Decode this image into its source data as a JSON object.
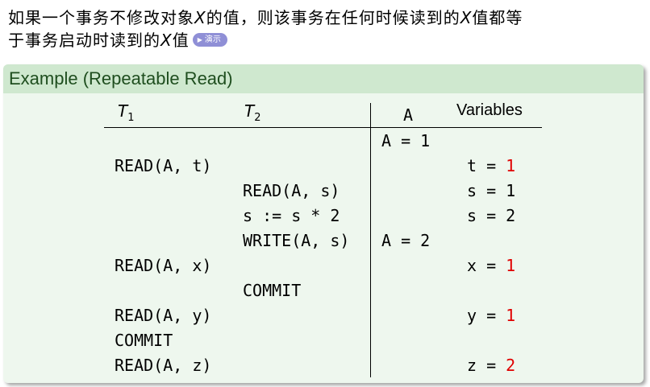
{
  "intro": {
    "line1_a": "如果一个事务不修改对象",
    "var_x": "X",
    "line1_b": "的值，则该事务在任何时候读到的",
    "line1_c": "值都等",
    "line2_a": "于事务启动时读到的",
    "line2_b": "值",
    "demo_label": "演示"
  },
  "block": {
    "title": "Example (Repeatable Read)"
  },
  "table": {
    "headers": {
      "t1": "T",
      "t1_sub": "1",
      "t2": "T",
      "t2_sub": "2",
      "a": "A",
      "vars": "Variables"
    },
    "a_cells": [
      "A = 1",
      "A = 2"
    ],
    "t1_cells": [
      "READ(A, t)",
      "READ(A, x)",
      "READ(A, y)",
      "COMMIT",
      "READ(A, z)"
    ],
    "t2_cells": [
      "READ(A, s)",
      "s := s * 2",
      "WRITE(A, s)",
      "COMMIT"
    ],
    "vars": [
      {
        "name": "t",
        "value": "1",
        "highlight": true
      },
      {
        "name": "s",
        "value": "1",
        "highlight": false
      },
      {
        "name": "s",
        "value": "2",
        "highlight": false
      },
      {
        "name": "x",
        "value": "1",
        "highlight": true
      },
      {
        "name": "y",
        "value": "1",
        "highlight": true
      },
      {
        "name": "z",
        "value": "2",
        "highlight": true
      }
    ],
    "eq": " = "
  },
  "colors": {
    "highlight": "#e00000",
    "title_bar": "#cfe8cf",
    "body": "#eef7ee",
    "demo_button": "#8f8fd6"
  }
}
